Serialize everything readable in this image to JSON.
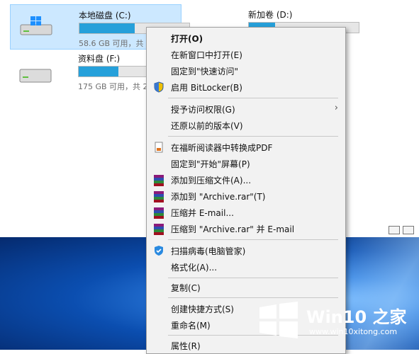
{
  "drives": [
    {
      "name": "本地磁盘 (C:)",
      "space": "58.6 GB 可用，共 1",
      "fill": 0.5
    },
    {
      "name": "新加卷 (D:)",
      "space": "",
      "fill": 0.24
    },
    {
      "name": "资料盘 (F:)",
      "space": "175 GB 可用，共 27",
      "fill": 0.36
    }
  ],
  "menu": {
    "open": "打开(O)",
    "open_new_window": "在新窗口中打开(E)",
    "pin_quick_access": "固定到\"快速访问\"",
    "bitlocker": "启用 BitLocker(B)",
    "grant_access": "授予访问权限(G)",
    "restore_versions": "还原以前的版本(V)",
    "foxit_pdf": "在福昕阅读器中转换成PDF",
    "pin_start": "固定到\"开始\"屏幕(P)",
    "add_archive": "添加到压缩文件(A)...",
    "add_to_rar": "添加到 \"Archive.rar\"(T)",
    "compress_email": "压缩并 E-mail...",
    "compress_rar_email": "压缩到 \"Archive.rar\" 并 E-mail",
    "scan_virus": "扫描病毒(电脑管家)",
    "format": "格式化(A)...",
    "copy": "复制(C)",
    "create_shortcut": "创建快捷方式(S)",
    "rename": "重命名(M)",
    "properties": "属性(R)"
  },
  "watermark": {
    "brand": "Win10 之家",
    "url": "www.win10xitong.com"
  },
  "colors": {
    "accent": "#26a0da",
    "selection": "#cce8ff"
  }
}
